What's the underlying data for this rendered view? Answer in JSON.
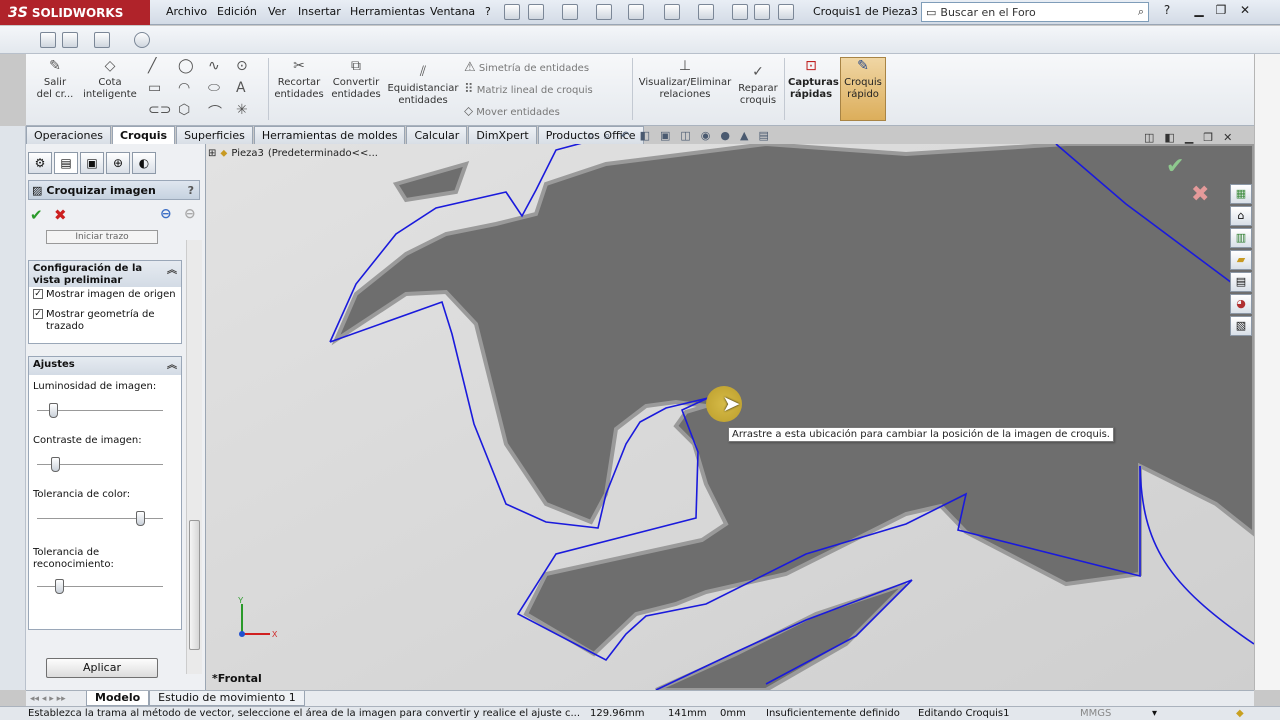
{
  "app": {
    "brand": "SOLIDWORKS",
    "brand_mark": "3S",
    "doc_title": "Croquis1 de Pieza3 *"
  },
  "menu": [
    "Archivo",
    "Edición",
    "Ver",
    "Insertar",
    "Herramientas",
    "Ventana",
    "?"
  ],
  "search": {
    "placeholder": "Buscar en el Foro"
  },
  "command_manager": {
    "exit_sketch": "Salir\ndel cr...",
    "smart_dim": "Cota\ninteligente",
    "trim": "Recortar\nentidades",
    "convert": "Convertir\nentidades",
    "offset": "Equidistanciar\nentidades",
    "mirror": "Simetría de entidades",
    "linear_pattern": "Matriz lineal de croquis",
    "move": "Mover entidades",
    "display_relations": "Visualizar/Eliminar\nrelaciones",
    "repair": "Reparar\ncroquis",
    "rapid_snaps": "Capturas\nrápidas",
    "rapid_sketch": "Croquis\nrápido"
  },
  "tabs": [
    "Operaciones",
    "Croquis",
    "Superficies",
    "Herramientas de moldes",
    "Calcular",
    "DimXpert",
    "Productos Office"
  ],
  "active_tab": "Croquis",
  "panel": {
    "title": "Croquizar imagen",
    "help": "?",
    "start_trace": "Iniciar trazo",
    "preview_group": "Configuración de la vista preliminar",
    "show_source": "Mostrar imagen de origen",
    "show_trace": "Mostrar geometría de trazado",
    "adjust_group": "Ajustes",
    "brightness": "Luminosidad de imagen:",
    "contrast": "Contraste de imagen:",
    "color_tol": "Tolerancia de color:",
    "recog_tol": "Tolerancia de reconocimiento:",
    "apply": "Aplicar",
    "brightness_value": 0.1,
    "contrast_value": 0.12,
    "color_tol_value": 0.85,
    "recog_tol_value": 0.15
  },
  "tree": {
    "item": "Pieza3",
    "config": "(Predeterminado<<..."
  },
  "view": {
    "label": "*Frontal",
    "axis_x": "X",
    "axis_y": "Y"
  },
  "tooltip": "Arrastre a esta ubicación para cambiar la posición de la imagen de croquis.",
  "bottom_tabs": [
    "Modelo",
    "Estudio de movimiento 1"
  ],
  "status": {
    "message": "Establezca la trama al método de vector, seleccione el área de la imagen para convertir y realice el ajuste c...",
    "x": "129.96mm",
    "y": "141mm",
    "z": "0mm",
    "state": "Insuficientemente definido",
    "editing": "Editando Croquis1",
    "units": "MMGS"
  },
  "colors": {
    "brand_red": "#b0232a",
    "trace_blue": "#1a1adc",
    "shape_gray": "#6e6e6e"
  }
}
